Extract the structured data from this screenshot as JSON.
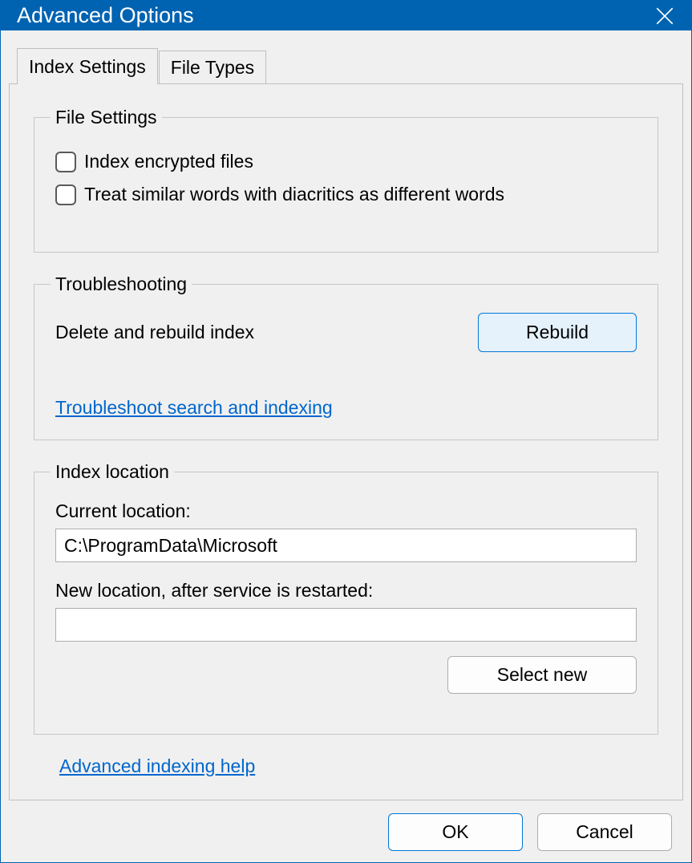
{
  "title": "Advanced Options",
  "tabs": {
    "index_settings": "Index Settings",
    "file_types": "File Types"
  },
  "file_settings": {
    "legend": "File Settings",
    "cb_encrypted": "Index encrypted files",
    "cb_diacritics": "Treat similar words with diacritics as different words"
  },
  "troubleshooting": {
    "legend": "Troubleshooting",
    "rebuild_label": "Delete and rebuild index",
    "rebuild_btn": "Rebuild",
    "troubleshoot_link": "Troubleshoot search and indexing"
  },
  "index_location": {
    "legend": "Index location",
    "current_label": "Current location:",
    "current_value": "C:\\ProgramData\\Microsoft",
    "new_label": "New location, after service is restarted:",
    "new_value": "",
    "select_new_btn": "Select new"
  },
  "help_link": "Advanced indexing help",
  "footer": {
    "ok": "OK",
    "cancel": "Cancel"
  }
}
